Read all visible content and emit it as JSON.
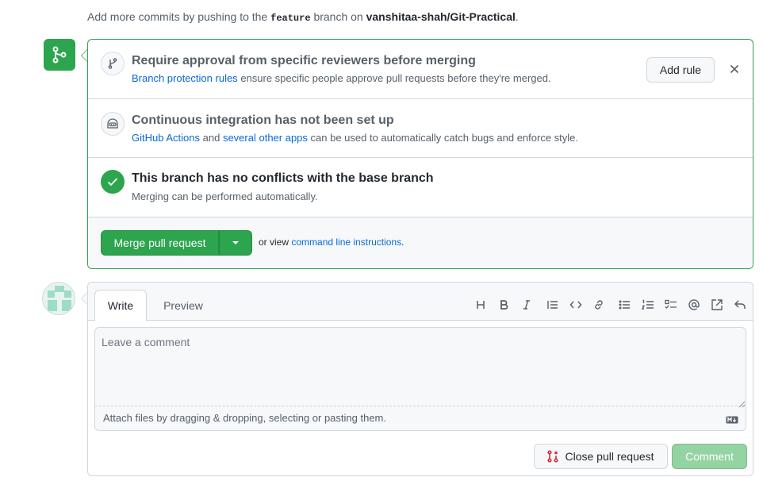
{
  "hint": {
    "prefix": "Add more commits by pushing to the",
    "branch": "feature",
    "middle": "branch on",
    "repo": "vanshitaa-shah/Git-Practical",
    "suffix": "."
  },
  "mergebox": {
    "reviewers": {
      "title": "Require approval from specific reviewers before merging",
      "link": "Branch protection rules",
      "desc": "ensure specific people approve pull requests before they're merged.",
      "add_rule_label": "Add rule",
      "icon": "git-branch-icon"
    },
    "ci": {
      "title": "Continuous integration has not been set up",
      "link1": "GitHub Actions",
      "and": "and",
      "link2": "several other apps",
      "desc": "can be used to automatically catch bugs and enforce style.",
      "icon": "actions-icon"
    },
    "conflicts": {
      "title": "This branch has no conflicts with the base branch",
      "desc": "Merging can be performed automatically.",
      "icon": "check-icon"
    },
    "merge": {
      "button_label": "Merge pull request",
      "or_view": "or view",
      "cli_link": "command line instructions",
      "period": "."
    }
  },
  "comment": {
    "tabs": {
      "write": "Write",
      "preview": "Preview"
    },
    "placeholder": "Leave a comment",
    "attach_text": "Attach files by dragging & dropping, selecting or pasting them.",
    "close_pr_label": "Close pull request",
    "comment_label": "Comment",
    "toolbar": [
      "heading-icon",
      "bold-icon",
      "italic-icon",
      "quote-icon",
      "code-icon",
      "link-icon",
      "unordered-list-icon",
      "ordered-list-icon",
      "task-list-icon",
      "mention-icon",
      "reference-icon",
      "reply-icon"
    ]
  },
  "colors": {
    "success": "#2da44e",
    "link": "#0969da",
    "danger": "#cf222e",
    "comment_disabled": "#94d3a2"
  }
}
